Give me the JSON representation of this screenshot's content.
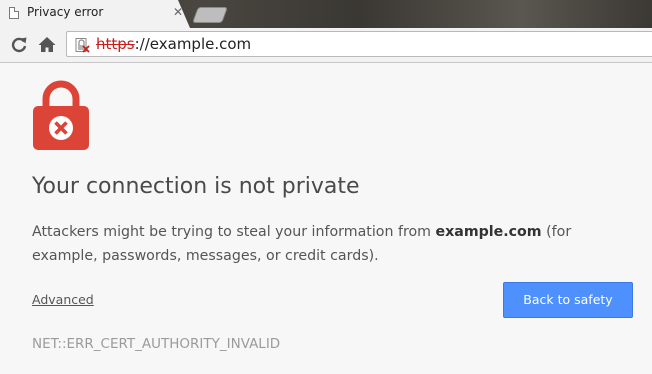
{
  "tab": {
    "title": "Privacy error",
    "close_glyph": "✕",
    "page_icon": "page-icon"
  },
  "toolbar": {
    "reload_icon": "reload-icon",
    "home_icon": "home-icon"
  },
  "omnibox": {
    "security_icon": "broken-lock-icon",
    "scheme": "https",
    "separator": "://",
    "host": "example.com"
  },
  "interstitial": {
    "icon": "red-lock-x-icon",
    "heading": "Your connection is not private",
    "explanation_prefix": "Attackers might be trying to steal your information from ",
    "explanation_host": "example.com",
    "explanation_suffix": " (for example, passwords, messages, or credit cards).",
    "advanced_label": "Advanced",
    "back_button_label": "Back to safety",
    "error_code": "NET::ERR_CERT_AUTHORITY_INVALID"
  },
  "colors": {
    "lock_red": "#db4437",
    "button_blue": "#4d90fe",
    "scheme_red": "#c5221f",
    "page_background": "#f7f7f7"
  }
}
